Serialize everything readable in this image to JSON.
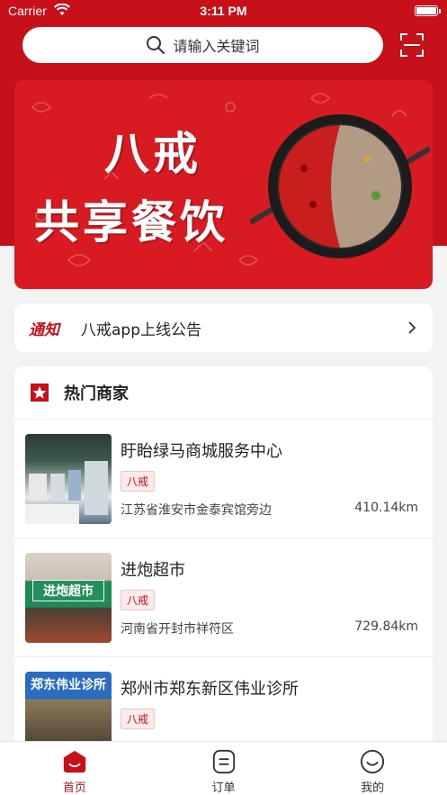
{
  "status_bar": {
    "carrier": "Carrier",
    "time": "3:11 PM"
  },
  "search": {
    "placeholder": "请输入关键词"
  },
  "banner": {
    "line1": "八戒",
    "line2": "共享餐饮"
  },
  "notice": {
    "tag": "通知",
    "text": "八戒app上线公告"
  },
  "hot_shops": {
    "title": "热门商家",
    "items": [
      {
        "name": "盱眙绿马商城服务中心",
        "badge": "八戒",
        "address": "江苏省淮安市金泰宾馆旁边",
        "distance": "410.14km"
      },
      {
        "name": "进炮超市",
        "badge": "八戒",
        "address": "河南省开封市祥符区",
        "distance": "729.84km",
        "thumb_sign": "进炮超市"
      },
      {
        "name": "郑州市郑东新区伟业诊所",
        "badge": "八戒",
        "thumb_sign": "郑东伟业诊所"
      }
    ]
  },
  "tab_bar": {
    "items": [
      {
        "label": "首页",
        "icon": "home-icon",
        "active": true
      },
      {
        "label": "订单",
        "icon": "order-icon",
        "active": false
      },
      {
        "label": "我的",
        "icon": "profile-icon",
        "active": false
      }
    ]
  },
  "colors": {
    "brand_red": "#c8101a",
    "background": "#f3f3f3"
  }
}
